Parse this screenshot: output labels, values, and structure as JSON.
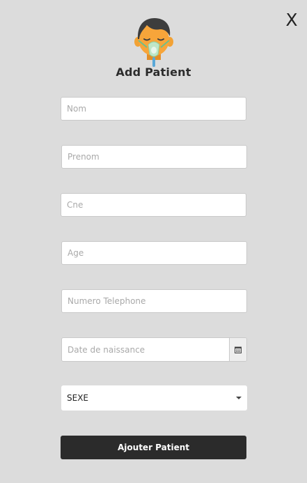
{
  "modal": {
    "close_label": "X",
    "title": "Add Patient",
    "avatar_icon": "patient-oxygen-mask-icon"
  },
  "form": {
    "nom_placeholder": "Nom",
    "prenom_placeholder": "Prenom",
    "cne_placeholder": "Cne",
    "age_placeholder": "Age",
    "phone_placeholder": "Numero Telephone",
    "birthdate_placeholder": "Date de naissance",
    "calendar_icon": "calendar-icon",
    "sexe_selected": "SEXE",
    "submit_label": "Ajouter Patient"
  },
  "colors": {
    "background": "#dcdcdc",
    "button": "#2b2b2b",
    "avatar_skin": "#f7a53a",
    "mask": "#bfe6c8"
  }
}
